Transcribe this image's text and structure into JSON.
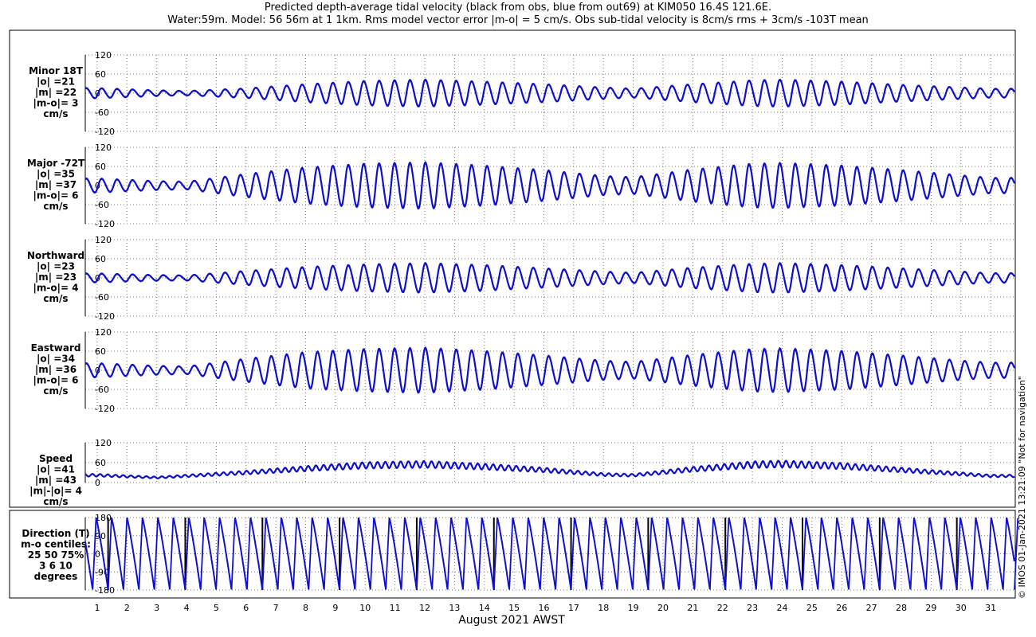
{
  "title_line1": "Predicted depth-average tidal velocity (black from obs, blue from out69) at KIM050 16.4S 121.6E.",
  "title_line2": "Water:59m. Model: 56 56m at 1 1km. Rms model vector error |m-o| = 5 cm/s. Obs sub-tidal velocity is 8cm/s rms + 3cm/s -103T mean",
  "xlabel": "August 2021 AWST",
  "credit": "© IMOS 01-Jan-2021 13:21:09  \"Not for navigation\"",
  "colors": {
    "model": "#1010cc",
    "obs": "#000000",
    "grid": "#777777"
  },
  "chart_data": {
    "type": "line",
    "x_unit": "day of August 2021",
    "xlim": [
      0.6,
      31.8
    ],
    "x_ticks": [
      "1",
      "2",
      "3",
      "4",
      "5",
      "6",
      "7",
      "8",
      "9",
      "10",
      "11",
      "12",
      "13",
      "14",
      "15",
      "16",
      "17",
      "18",
      "19",
      "20",
      "21",
      "22",
      "23",
      "24",
      "25",
      "26",
      "27",
      "28",
      "29",
      "30",
      "31"
    ],
    "grid": true,
    "series": [
      {
        "name": "obs",
        "color": "#000000"
      },
      {
        "name": "model",
        "color": "#1010cc"
      }
    ],
    "panels": [
      {
        "id": "minor",
        "label_lines": [
          "Minor 18T",
          "|o| =21",
          "|m| =22",
          "|m-o|= 3",
          "cm/s"
        ],
        "ylim": [
          -120,
          120
        ],
        "yticks": [
          "120",
          "60",
          "0",
          "-60",
          "-120"
        ],
        "amplitude_by_day": [
          [
            1,
            16
          ],
          [
            3,
            9
          ],
          [
            4,
            7
          ],
          [
            6,
            15
          ],
          [
            8,
            28
          ],
          [
            10,
            38
          ],
          [
            12,
            42
          ],
          [
            14,
            36
          ],
          [
            16,
            28
          ],
          [
            18,
            18
          ],
          [
            19,
            14
          ],
          [
            21,
            28
          ],
          [
            23,
            40
          ],
          [
            24,
            42
          ],
          [
            26,
            36
          ],
          [
            28,
            26
          ],
          [
            30,
            18
          ],
          [
            31,
            14
          ]
        ]
      },
      {
        "id": "major",
        "label_lines": [
          "Major -72T",
          "|o| =35",
          "|m| =37",
          "|m-o|= 6",
          "cm/s"
        ],
        "ylim": [
          -120,
          120
        ],
        "yticks": [
          "120",
          "60",
          "0",
          "-60",
          "-120"
        ],
        "amplitude_by_day": [
          [
            1,
            22
          ],
          [
            3,
            14
          ],
          [
            4,
            12
          ],
          [
            6,
            36
          ],
          [
            8,
            56
          ],
          [
            10,
            68
          ],
          [
            12,
            72
          ],
          [
            14,
            62
          ],
          [
            16,
            48
          ],
          [
            18,
            30
          ],
          [
            19,
            26
          ],
          [
            21,
            50
          ],
          [
            23,
            68
          ],
          [
            24,
            70
          ],
          [
            26,
            62
          ],
          [
            28,
            48
          ],
          [
            30,
            32
          ],
          [
            31,
            24
          ]
        ]
      },
      {
        "id": "northward",
        "label_lines": [
          "Northward",
          "|o| =23",
          "|m| =23",
          "|m-o|= 4",
          "cm/s"
        ],
        "ylim": [
          -120,
          120
        ],
        "yticks": [
          "120",
          "60",
          "0",
          "-60",
          "-120"
        ],
        "amplitude_by_day": [
          [
            1,
            14
          ],
          [
            3,
            9
          ],
          [
            4,
            8
          ],
          [
            6,
            22
          ],
          [
            8,
            34
          ],
          [
            10,
            42
          ],
          [
            12,
            46
          ],
          [
            14,
            40
          ],
          [
            16,
            30
          ],
          [
            18,
            20
          ],
          [
            19,
            16
          ],
          [
            21,
            32
          ],
          [
            23,
            44
          ],
          [
            24,
            46
          ],
          [
            26,
            40
          ],
          [
            28,
            30
          ],
          [
            30,
            20
          ],
          [
            31,
            15
          ]
        ]
      },
      {
        "id": "eastward",
        "label_lines": [
          "Eastward",
          "|o| =34",
          "|m| =36",
          "|m-o|= 6",
          "cm/s"
        ],
        "ylim": [
          -120,
          120
        ],
        "yticks": [
          "120",
          "60",
          "0",
          "-60",
          "-120"
        ],
        "amplitude_by_day": [
          [
            1,
            22
          ],
          [
            3,
            14
          ],
          [
            4,
            12
          ],
          [
            6,
            36
          ],
          [
            8,
            56
          ],
          [
            10,
            66
          ],
          [
            12,
            70
          ],
          [
            14,
            60
          ],
          [
            16,
            46
          ],
          [
            18,
            30
          ],
          [
            19,
            26
          ],
          [
            21,
            48
          ],
          [
            23,
            66
          ],
          [
            24,
            68
          ],
          [
            26,
            60
          ],
          [
            28,
            46
          ],
          [
            30,
            30
          ],
          [
            31,
            24
          ]
        ]
      },
      {
        "id": "speed",
        "label_lines": [
          "Speed",
          "|o| =41",
          "|m| =43",
          "|m|-|o|= 4",
          "cm/s"
        ],
        "ylim": [
          0,
          120
        ],
        "yticks": [
          "120",
          "60",
          "0"
        ],
        "mean_by_day": [
          [
            1,
            22
          ],
          [
            3,
            15
          ],
          [
            4,
            20
          ],
          [
            6,
            30
          ],
          [
            8,
            42
          ],
          [
            10,
            52
          ],
          [
            12,
            55
          ],
          [
            14,
            48
          ],
          [
            16,
            38
          ],
          [
            18,
            24
          ],
          [
            19,
            22
          ],
          [
            21,
            40
          ],
          [
            23,
            54
          ],
          [
            24,
            56
          ],
          [
            26,
            50
          ],
          [
            28,
            38
          ],
          [
            30,
            26
          ],
          [
            31,
            20
          ]
        ]
      },
      {
        "id": "direction",
        "label_lines": [
          "Direction (T)",
          "m-o centiles:",
          "25  50  75%",
          "3  6 10",
          "degrees"
        ],
        "ylim": [
          -180,
          180
        ],
        "yticks": [
          "180",
          "90",
          "0",
          "-90",
          "-180"
        ],
        "wraps_per_day": 1.93
      }
    ]
  }
}
